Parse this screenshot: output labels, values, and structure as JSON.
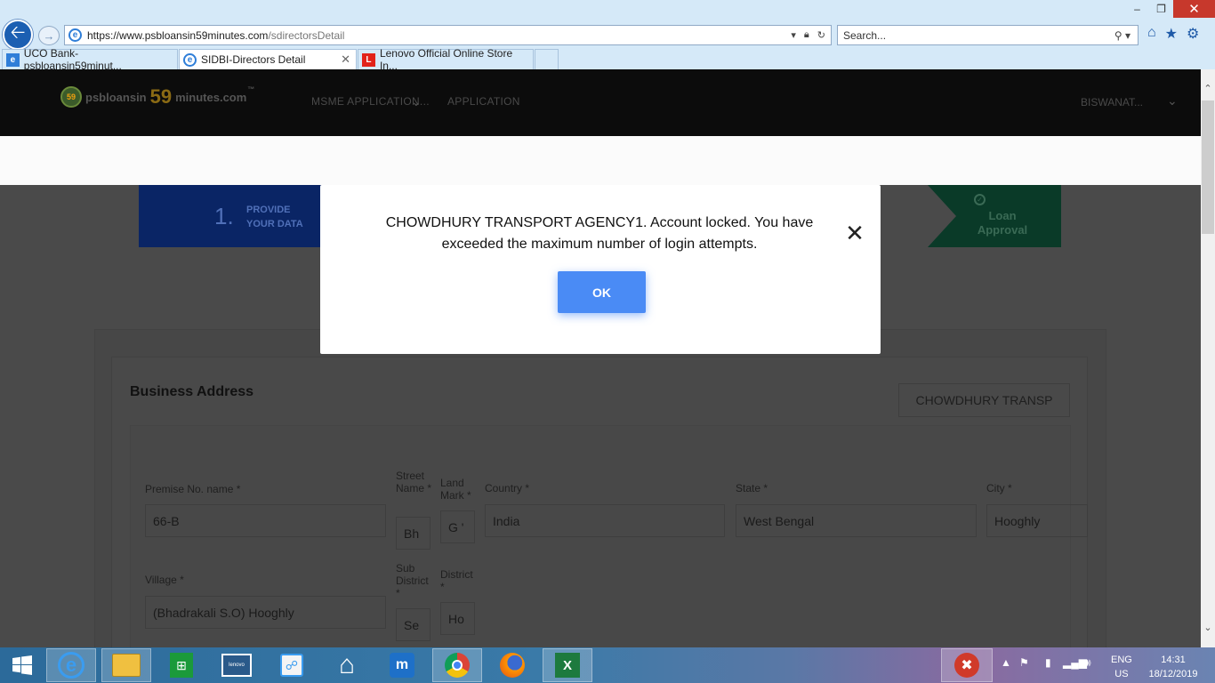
{
  "browser": {
    "url_bold": "https://www.psbloansin59minutes.com",
    "url_rest": "/sdirectorsDetail",
    "search_placeholder": "Search...",
    "tabs": [
      {
        "label": "UCO Bank- psbloansin59minut...",
        "icon": "ie-icon"
      },
      {
        "label": "SIDBI-Directors Detail",
        "icon": "ie-icon",
        "active": true
      },
      {
        "label": "Lenovo Official Online Store In...",
        "icon": "lenovo-icon"
      }
    ]
  },
  "site": {
    "logo_prefix": "psbloansin",
    "logo_number": "59",
    "logo_suffix": "minutes.com",
    "logo_tm": "™",
    "logo_badge": "59",
    "nav": [
      "MSME APPLICATION...",
      "APPLICATION"
    ],
    "user": "BISWANAT..."
  },
  "steps": {
    "first_number": "1.",
    "first_label_1": "PROVIDE",
    "first_label_2": "YOUR DATA",
    "last_label_1": "Loan",
    "last_label_2": "Approval"
  },
  "page": {
    "section_title": "Business Address",
    "company_box": "CHOWDHURY TRANSP",
    "fields": {
      "premise_label": "Premise No. name *",
      "premise_value": "66-B",
      "street_label": "Street Name *",
      "street_value": "Bh",
      "landmark_label": "Land Mark *",
      "landmark_value": "G '",
      "country_label": "Country *",
      "country_value": "India",
      "state_label": "State *",
      "state_value": "West Bengal",
      "city_label": "City *",
      "city_value": "Hooghly",
      "village_label": "Village *",
      "village_value": "(Bhadrakali S.O) Hooghly",
      "subdistrict_label": "Sub District *",
      "subdistrict_value": "Se",
      "district_label": "District *",
      "district_value": "Ho"
    }
  },
  "modal": {
    "message": "CHOWDHURY TRANSPORT AGENCY1. Account locked. You have exceeded the maximum number of login attempts.",
    "ok_label": "OK"
  },
  "taskbar": {
    "lang": "ENG",
    "region": "US",
    "time": "14:31",
    "date": "18/12/2019"
  }
}
